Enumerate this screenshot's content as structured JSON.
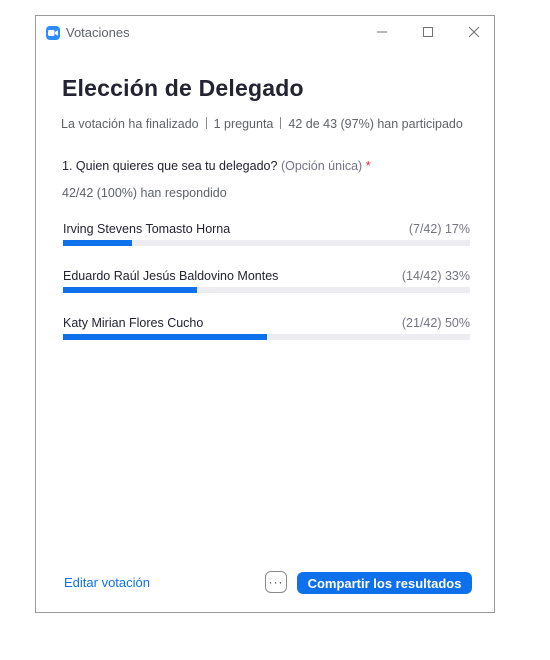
{
  "window": {
    "title": "Votaciones",
    "icon": "zoom-camera-icon",
    "controls": [
      "minimize-icon",
      "maximize-icon",
      "close-icon"
    ]
  },
  "poll": {
    "title": "Elección de Delegado",
    "status": "La votación ha finalizado",
    "question_count": "1 pregunta",
    "participation": "42 de 43 (97%) han participado"
  },
  "question": {
    "text": "1. Quien quieres que sea tu delegado?",
    "type": "(Opción única)",
    "required_mark": "*",
    "answered": "42/42 (100%) han respondido",
    "options": [
      {
        "label": "Irving Stevens Tomasto Horna",
        "stat": "(7/42) 17%",
        "fraction": 0.17
      },
      {
        "label": "Eduardo Raúl Jesús Baldovino Montes",
        "stat": "(14/42) 33%",
        "fraction": 0.33
      },
      {
        "label": "Katy Mirian Flores Cucho",
        "stat": "(21/42) 50%",
        "fraction": 0.5
      }
    ]
  },
  "footer": {
    "edit_link": "Editar votación",
    "more_label": "···",
    "share_button": "Compartir los resultados"
  },
  "colors": {
    "accent": "#0e71eb",
    "track": "#ededf1",
    "required": "#e02828",
    "title_text": "#232333"
  }
}
